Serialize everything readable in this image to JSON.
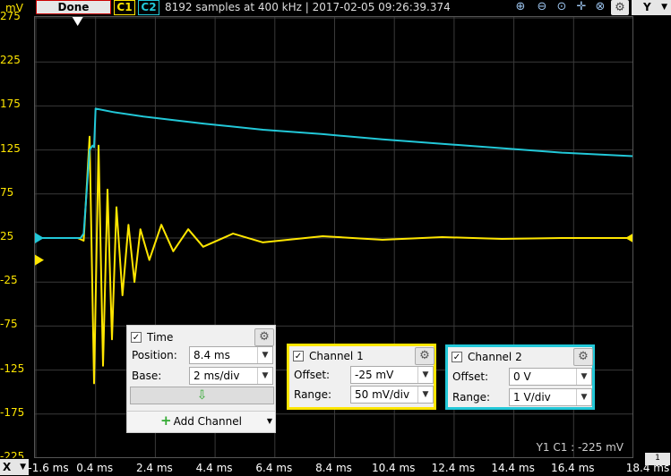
{
  "toolbar": {
    "done_label": "Done",
    "c1_label": "C1",
    "c2_label": "C2",
    "info": "8192 samples at 400 kHz | 2017-02-05 09:26:39.374",
    "y_button_label": "Y"
  },
  "y_axis": {
    "unit": "mV",
    "ticks": [
      "275",
      "225",
      "175",
      "125",
      "75",
      "25",
      "-25",
      "-75",
      "-125",
      "-175",
      "-225"
    ]
  },
  "x_axis": {
    "button_label": "X",
    "ticks": [
      "-1.6 ms",
      "0.4 ms",
      "2.4 ms",
      "4.4 ms",
      "6.4 ms",
      "8.4 ms",
      "10.4 ms",
      "12.4 ms",
      "14.4 ms",
      "16.4 ms",
      "18.4 ms"
    ],
    "right_button_label": "1"
  },
  "cursor_readout": "Y1 C1 : -225 mV",
  "time_panel": {
    "title": "Time",
    "position_label": "Position:",
    "position_value": "8.4 ms",
    "base_label": "Base:",
    "base_value": "2 ms/div",
    "add_channel_label": "Add Channel"
  },
  "channel1_panel": {
    "title": "Channel 1",
    "offset_label": "Offset:",
    "offset_value": "-25 mV",
    "range_label": "Range:",
    "range_value": "50 mV/div",
    "color": "#ffe600"
  },
  "channel2_panel": {
    "title": "Channel 2",
    "offset_label": "Offset:",
    "offset_value": "0 V",
    "range_label": "Range:",
    "range_value": "1 V/div",
    "color": "#22c8d8"
  },
  "chart_data": {
    "type": "line",
    "xlabel": "",
    "ylabel": "mV",
    "xlim": [
      -1.6,
      18.4
    ],
    "ylim": [
      -225,
      275
    ],
    "grid": true,
    "series": [
      {
        "name": "C1",
        "color": "#ffe600",
        "x": [
          -1.6,
          -0.2,
          0.0,
          0.2,
          0.35,
          0.5,
          0.65,
          0.8,
          0.95,
          1.1,
          1.3,
          1.5,
          1.7,
          1.9,
          2.2,
          2.6,
          3.0,
          3.5,
          4.0,
          5.0,
          6.0,
          8.0,
          10.0,
          12.0,
          14.0,
          16.0,
          18.4
        ],
        "values": [
          25,
          25,
          22,
          140,
          -140,
          130,
          -120,
          80,
          -90,
          60,
          -40,
          40,
          -25,
          35,
          0,
          40,
          10,
          35,
          15,
          30,
          20,
          27,
          23,
          26,
          24,
          25,
          25
        ]
      },
      {
        "name": "C2",
        "color": "#22c8d8",
        "x": [
          -1.6,
          -0.1,
          0.0,
          0.2,
          0.3,
          0.35,
          0.4,
          1.0,
          2.0,
          4.0,
          6.0,
          8.0,
          10.0,
          12.0,
          14.0,
          16.0,
          18.4
        ],
        "values": [
          25,
          25,
          30,
          125,
          130,
          128,
          172,
          168,
          163,
          155,
          148,
          143,
          137,
          132,
          127,
          122,
          118
        ]
      }
    ]
  }
}
